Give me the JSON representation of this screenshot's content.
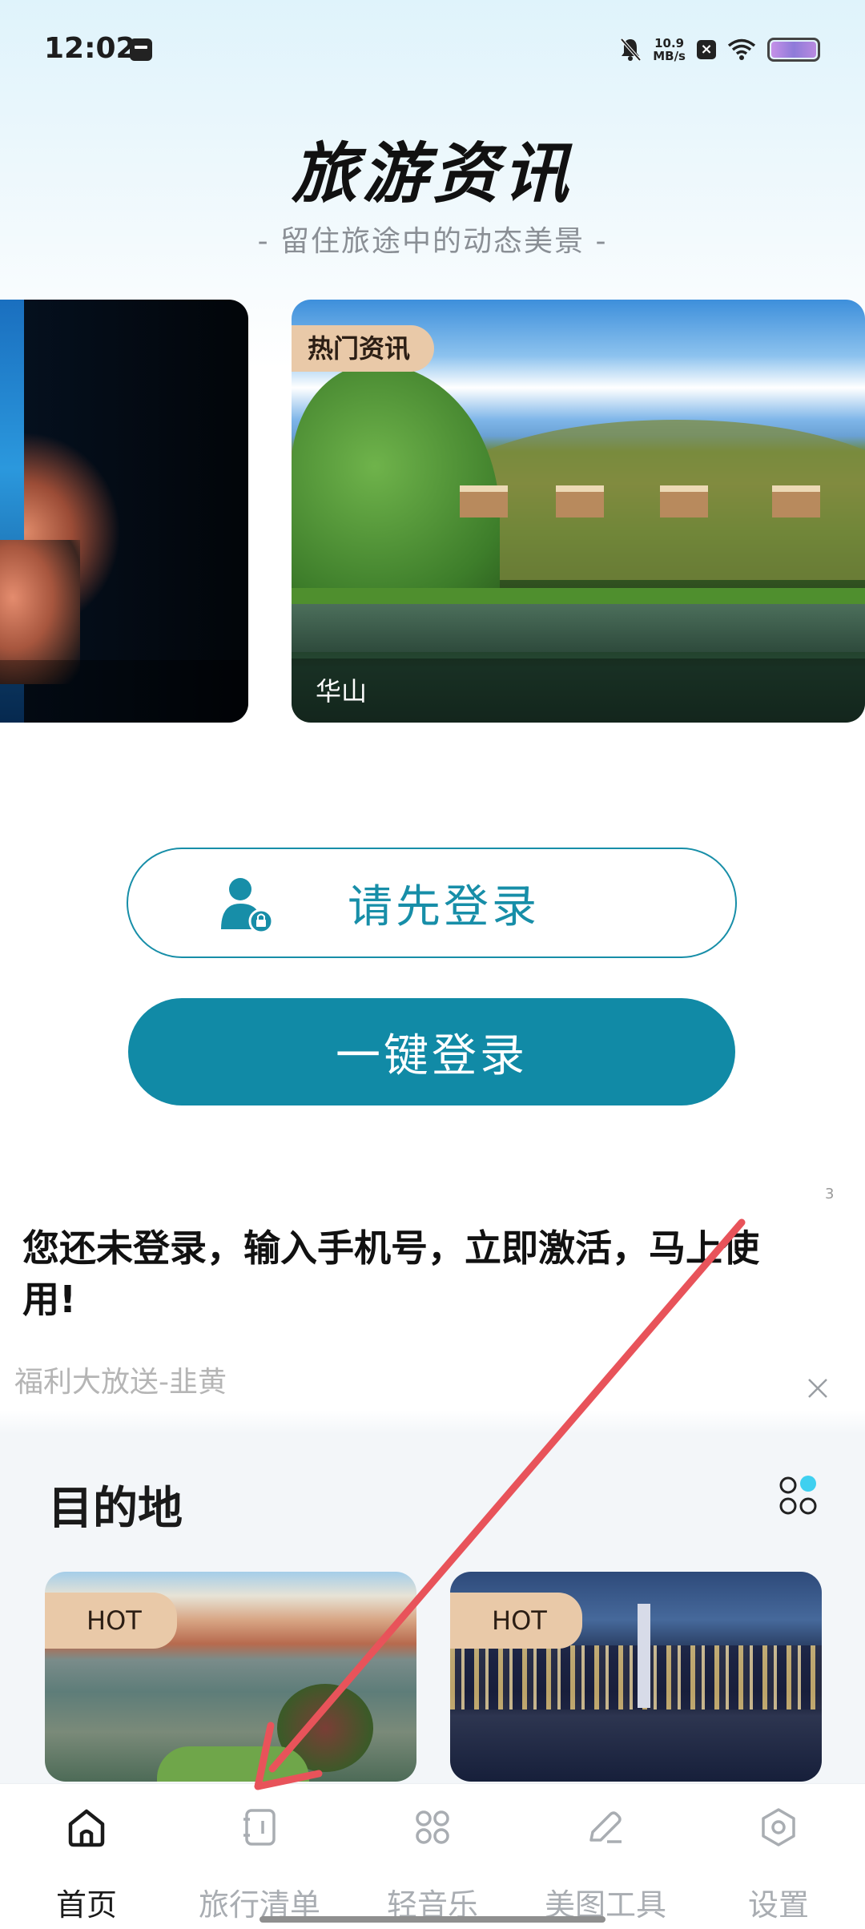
{
  "status_bar": {
    "time": "12:02",
    "net_speed_value": "10.9",
    "net_speed_unit": "MB/s",
    "icons": [
      "app-icon",
      "bell-mute-icon",
      "x-icon",
      "wifi-icon",
      "battery-icon"
    ]
  },
  "header": {
    "title": "旅游资讯",
    "subtitle": "-  留住旅途中的动态美景  -"
  },
  "carousel": {
    "tag": "热门资讯",
    "main_caption": "华山"
  },
  "login": {
    "login_first_label": "请先登录",
    "one_key_label": "一键登录"
  },
  "notice": {
    "text": "您还未登录，输入手机号，立即激活，马上使用!",
    "promo": "福利大放送-韭黄",
    "tiny_mark": "3"
  },
  "destinations": {
    "title": "目的地",
    "cards": [
      {
        "tag": "HOT"
      },
      {
        "tag": "HOT"
      }
    ]
  },
  "bottom_nav": {
    "items": [
      {
        "label": "首页",
        "icon": "home-icon",
        "active": true
      },
      {
        "label": "旅行清单",
        "icon": "notebook-icon",
        "active": false
      },
      {
        "label": "轻音乐",
        "icon": "music-grid-icon",
        "active": false
      },
      {
        "label": "美图工具",
        "icon": "pencil-icon",
        "active": false
      },
      {
        "label": "设置",
        "icon": "settings-icon",
        "active": false
      }
    ]
  },
  "colors": {
    "accent": "#118aa6",
    "hot_tag": "#e9c9a8",
    "annotation_arrow": "#e8535a"
  }
}
